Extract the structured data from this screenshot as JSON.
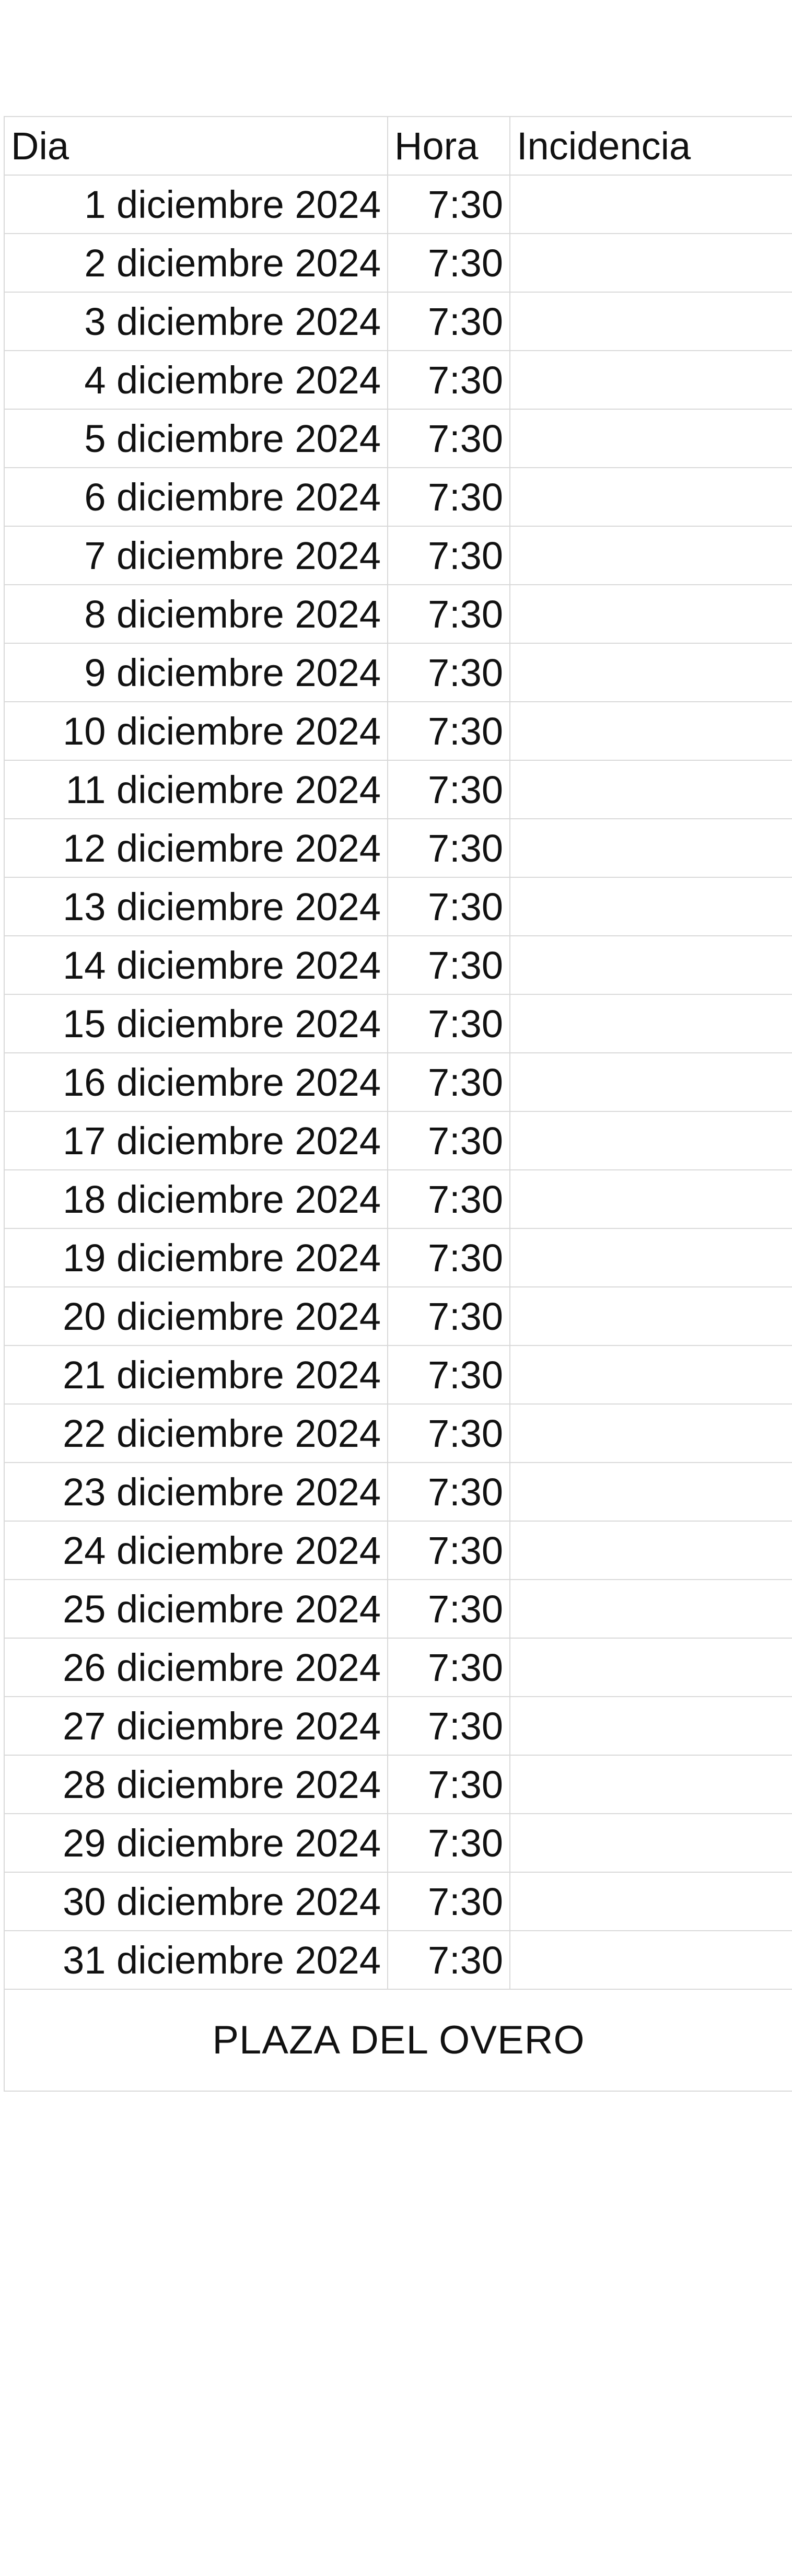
{
  "headers": {
    "dia": "Dia",
    "hora": "Hora",
    "incidencia": "Incidencia"
  },
  "rows": [
    {
      "dia": "1 diciembre 2024",
      "hora": "7:30",
      "incidencia": ""
    },
    {
      "dia": "2 diciembre 2024",
      "hora": "7:30",
      "incidencia": ""
    },
    {
      "dia": "3 diciembre 2024",
      "hora": "7:30",
      "incidencia": ""
    },
    {
      "dia": "4 diciembre 2024",
      "hora": "7:30",
      "incidencia": ""
    },
    {
      "dia": "5 diciembre 2024",
      "hora": "7:30",
      "incidencia": ""
    },
    {
      "dia": "6 diciembre 2024",
      "hora": "7:30",
      "incidencia": ""
    },
    {
      "dia": "7 diciembre 2024",
      "hora": "7:30",
      "incidencia": ""
    },
    {
      "dia": "8 diciembre 2024",
      "hora": "7:30",
      "incidencia": ""
    },
    {
      "dia": "9 diciembre 2024",
      "hora": "7:30",
      "incidencia": ""
    },
    {
      "dia": "10 diciembre 2024",
      "hora": "7:30",
      "incidencia": ""
    },
    {
      "dia": "11 diciembre 2024",
      "hora": "7:30",
      "incidencia": ""
    },
    {
      "dia": "12 diciembre 2024",
      "hora": "7:30",
      "incidencia": ""
    },
    {
      "dia": "13 diciembre 2024",
      "hora": "7:30",
      "incidencia": ""
    },
    {
      "dia": "14 diciembre 2024",
      "hora": "7:30",
      "incidencia": ""
    },
    {
      "dia": "15 diciembre 2024",
      "hora": "7:30",
      "incidencia": ""
    },
    {
      "dia": "16 diciembre 2024",
      "hora": "7:30",
      "incidencia": ""
    },
    {
      "dia": "17 diciembre 2024",
      "hora": "7:30",
      "incidencia": ""
    },
    {
      "dia": "18 diciembre 2024",
      "hora": "7:30",
      "incidencia": ""
    },
    {
      "dia": "19 diciembre 2024",
      "hora": "7:30",
      "incidencia": ""
    },
    {
      "dia": "20 diciembre 2024",
      "hora": "7:30",
      "incidencia": ""
    },
    {
      "dia": "21 diciembre 2024",
      "hora": "7:30",
      "incidencia": ""
    },
    {
      "dia": "22 diciembre 2024",
      "hora": "7:30",
      "incidencia": ""
    },
    {
      "dia": "23 diciembre 2024",
      "hora": "7:30",
      "incidencia": ""
    },
    {
      "dia": "24 diciembre 2024",
      "hora": "7:30",
      "incidencia": ""
    },
    {
      "dia": "25 diciembre 2024",
      "hora": "7:30",
      "incidencia": ""
    },
    {
      "dia": "26 diciembre 2024",
      "hora": "7:30",
      "incidencia": ""
    },
    {
      "dia": "27 diciembre 2024",
      "hora": "7:30",
      "incidencia": ""
    },
    {
      "dia": "28 diciembre 2024",
      "hora": "7:30",
      "incidencia": ""
    },
    {
      "dia": "29 diciembre 2024",
      "hora": "7:30",
      "incidencia": ""
    },
    {
      "dia": "30 diciembre 2024",
      "hora": "7:30",
      "incidencia": ""
    },
    {
      "dia": "31 diciembre 2024",
      "hora": "7:30",
      "incidencia": ""
    }
  ],
  "footer": "PLAZA DEL OVERO",
  "colors": {
    "grid_line": "#d9d9d9",
    "text": "#111111",
    "background": "#ffffff"
  }
}
